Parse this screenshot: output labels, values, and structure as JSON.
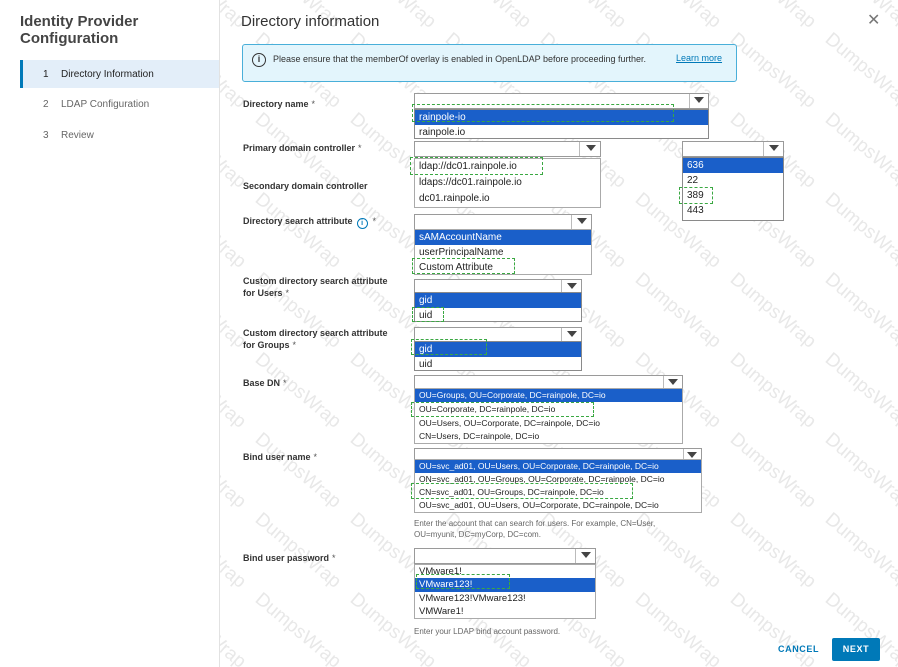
{
  "sidebar": {
    "title": "Identity Provider Configuration",
    "steps": [
      {
        "num": "1",
        "label": "Directory Information",
        "active": true
      },
      {
        "num": "2",
        "label": "LDAP Configuration",
        "active": false
      },
      {
        "num": "3",
        "label": "Review",
        "active": false
      }
    ]
  },
  "main": {
    "title": "Directory information",
    "banner": {
      "message": "Please ensure that the memberOf overlay is enabled in OpenLDAP before proceeding further.",
      "link": "Learn more"
    }
  },
  "fields": {
    "directory_name": {
      "label": "Directory name",
      "options": [
        "rainpole-io",
        "rainpole.io"
      ],
      "selected": "rainpole-io"
    },
    "primary_dc": {
      "label": "Primary domain controller",
      "options": [
        "ldap://dc01.rainpole.io",
        "ldaps://dc01.rainpole.io",
        "dc01.rainpole.io"
      ]
    },
    "port": {
      "options": [
        "636",
        "22",
        "389",
        "443"
      ],
      "selected": "636"
    },
    "secondary_dc": {
      "label": "Secondary domain controller"
    },
    "search_attr": {
      "label": "Directory search attribute",
      "options": [
        "sAMAccountName",
        "userPrincipalName",
        "Custom Attribute"
      ],
      "selected": "sAMAccountName"
    },
    "custom_users": {
      "label": "Custom directory search attribute for Users",
      "options": [
        "gid",
        "uid"
      ],
      "selected": "gid"
    },
    "custom_groups": {
      "label": "Custom directory search attribute for Groups",
      "options": [
        "gid",
        "uid"
      ],
      "selected": "gid"
    },
    "base_dn": {
      "label": "Base DN",
      "options": [
        "OU=Groups, OU=Corporate, DC=rainpole, DC=io",
        "OU=Corporate, DC=rainpole, DC=io",
        "OU=Users, OU=Corporate, DC=rainpole, DC=io",
        "CN=Users, DC=rainpole, DC=io"
      ],
      "selected": "OU=Groups, OU=Corporate, DC=rainpole, DC=io"
    },
    "bind_user": {
      "label": "Bind user name",
      "options": [
        "OU=svc_ad01, OU=Users, OU=Corporate, DC=rainpole, DC=io",
        "ON=svc_ad01, OU=Groups, OU=Corporate, DC=rainpole, DC=io",
        "CN=svc_ad01, OU=Groups, DC=rainpole, DC=io",
        "OU=svc_ad01, OU=Users, OU=Corporate, DC=rainpole, DC=io"
      ],
      "selected": "OU=svc_ad01, OU=Users, OU=Corporate, DC=rainpole, DC=io",
      "helper": "Enter the account that can search for users. For example, CN=User, OU=myunit, DC=myCorp, DC=com."
    },
    "bind_password": {
      "label": "Bind user password",
      "options": [
        "VMware1!",
        "VMware123!",
        "VMware123!VMware123!",
        "VMWare1!"
      ],
      "selected": "VMware123!",
      "helper": "Enter your LDAP bind account password."
    }
  },
  "required_mark": "*",
  "info_icon": "i",
  "close_icon": "✕",
  "footer": {
    "cancel": "CANCEL",
    "next": "NEXT"
  },
  "watermark": "DumpsWrap",
  "colors": {
    "accent": "#0079b8",
    "selected_option": "#1a5fc9",
    "banner_bg": "#e3f5fc",
    "highlight_dash": "#3aa842"
  }
}
